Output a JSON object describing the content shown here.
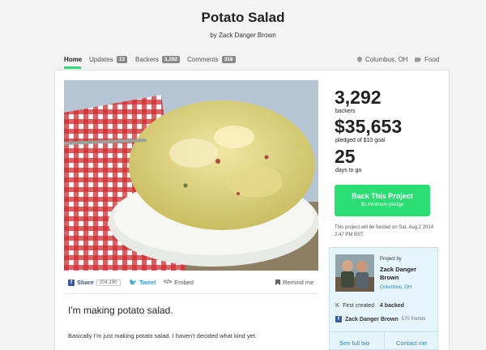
{
  "project": {
    "title": "Potato Salad",
    "byline": "by Zack Danger Brown"
  },
  "nav": {
    "home": "Home",
    "updates_label": "Updates",
    "updates_count": "13",
    "backers_label": "Backers",
    "backers_count": "3,292",
    "comments_label": "Comments",
    "comments_count": "318",
    "location": "Columbus, OH",
    "category": "Food"
  },
  "share": {
    "share_label": "Share",
    "share_count": "204,190",
    "tweet_label": "Tweet",
    "embed_label": "Embed",
    "remind_label": "Remind me"
  },
  "blurb": {
    "title": "I'm making potato salad.",
    "text": "Basically I'm just making potato salad. I haven't decided what kind yet."
  },
  "stats": {
    "backers_count": "3,292",
    "backers_label": "backers",
    "pledged_amount": "$35,653",
    "pledged_label": "pledged of $10 goal",
    "days_count": "25",
    "days_label": "days to go"
  },
  "cta": {
    "button_label": "Back This Project",
    "button_sub": "$1 minimum pledge",
    "funding_note": "This project will be funded on Sat, Aug 2 2014 2:47 PM BST."
  },
  "creator": {
    "project_by": "Project by",
    "name": "Zack Danger Brown",
    "location": "Columbus, OH",
    "first_created": "First created",
    "backed": "4 backed",
    "fb_name": "Zack Danger Brown",
    "fb_friends": "570 friends",
    "see_full_bio": "See full bio",
    "contact_me": "Contact me"
  },
  "colors": {
    "accent_green": "#2bde73",
    "link_blue": "#2a8ac9",
    "facebook_blue": "#3b5998",
    "twitter_blue": "#1da1f2"
  }
}
